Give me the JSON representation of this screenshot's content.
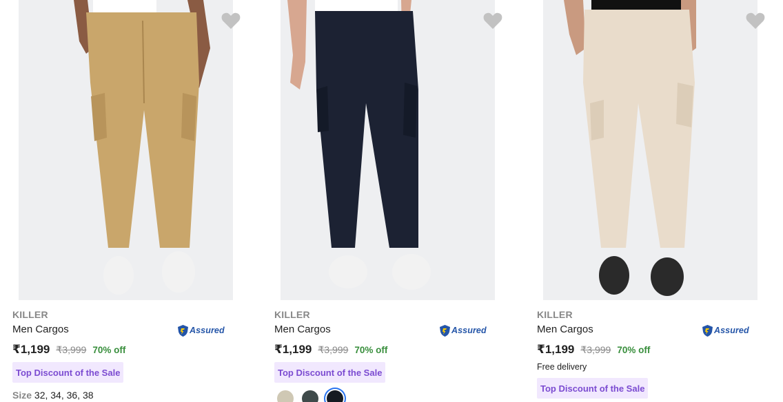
{
  "products": [
    {
      "brand": "KILLER",
      "title": "Men Cargos",
      "assured_label": "Assured",
      "price": "₹1,199",
      "mrp": "₹3,999",
      "discount": "70% off",
      "delivery": "",
      "tag": "Top Discount of the Sale",
      "sizes_label": "Size",
      "sizes": "32, 34, 36, 38",
      "pant_color": "#c9a66b",
      "shoe_color": "#f2f2f2",
      "icons": {
        "wishlist": "heart-icon",
        "assured": "shield-icon"
      }
    },
    {
      "brand": "KILLER",
      "title": "Men Cargos",
      "assured_label": "Assured",
      "price": "₹1,199",
      "mrp": "₹3,999",
      "discount": "70% off",
      "delivery": "",
      "tag": "Top Discount of the Sale",
      "swatches": [
        {
          "color": "#cfc8b4",
          "selected": false
        },
        {
          "color": "#3f4a4a",
          "selected": false
        },
        {
          "color": "#151a22",
          "selected": true
        }
      ],
      "pant_color": "#1c2233",
      "shoe_color": "#f2f2f2",
      "icons": {
        "wishlist": "heart-icon",
        "assured": "shield-icon"
      }
    },
    {
      "brand": "KILLER",
      "title": "Men Cargos",
      "assured_label": "Assured",
      "price": "₹1,199",
      "mrp": "₹3,999",
      "discount": "70% off",
      "delivery": "Free delivery",
      "tag": "Top Discount of the Sale",
      "pant_color": "#e9dccb",
      "shoe_color": "#2a2a2a",
      "icons": {
        "wishlist": "heart-icon",
        "assured": "shield-icon"
      }
    }
  ],
  "colors": {
    "price_text": "#212121",
    "muted_text": "#878787",
    "discount_green": "#388e3c",
    "tag_bg": "#f1e8fe",
    "tag_text": "#7b4bd1",
    "assured_blue": "#2455a8",
    "wishlist_grey": "#c2c2c2"
  }
}
